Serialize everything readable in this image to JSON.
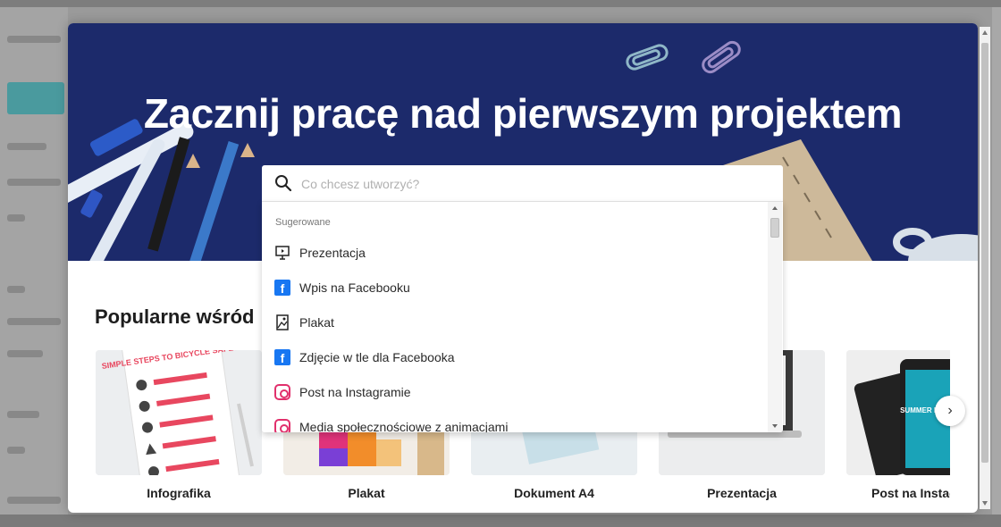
{
  "hero": {
    "title": "Zacznij pracę nad pierwszym projektem"
  },
  "search": {
    "placeholder": "Co chcesz utworzyć?"
  },
  "dropdown": {
    "heading": "Sugerowane",
    "items": [
      {
        "label": "Prezentacja",
        "icon": "presentation-icon"
      },
      {
        "label": "Wpis na Facebooku",
        "icon": "facebook-icon"
      },
      {
        "label": "Plakat",
        "icon": "poster-icon"
      },
      {
        "label": "Zdjęcie w tle dla Facebooka",
        "icon": "facebook-icon"
      },
      {
        "label": "Post na Instagramie",
        "icon": "instagram-icon"
      },
      {
        "label": "Media społecznościowe z animacjami",
        "icon": "instagram-icon"
      }
    ]
  },
  "popular": {
    "title": "Popularne wśród",
    "cards": [
      {
        "label": "Infografika"
      },
      {
        "label": "Plakat"
      },
      {
        "label": "Dokument A4"
      },
      {
        "label": "Prezentacja"
      },
      {
        "label": "Post na Instagramie"
      }
    ]
  },
  "thumbs": {
    "infographic_heading": "SIMPLE STEPS TO BICYCLE SAFETY",
    "instagram_text": "SUMMER IS HERE"
  },
  "colors": {
    "hero_bg": "#1c2a6b",
    "facebook": "#1877f2",
    "instagram": "#e1306c"
  }
}
